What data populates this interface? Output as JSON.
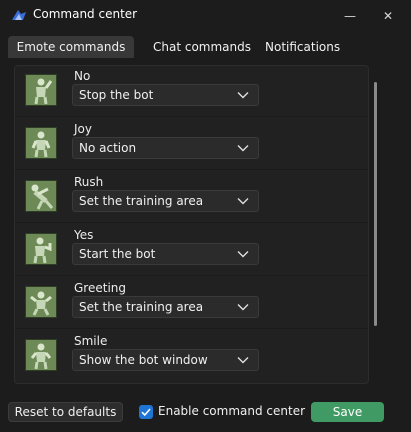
{
  "window": {
    "title": "Command center"
  },
  "tabs": [
    {
      "label": "Emote commands",
      "active": true
    },
    {
      "label": "Chat commands",
      "active": false
    },
    {
      "label": "Notifications",
      "active": false
    }
  ],
  "emotes": [
    {
      "name": "No",
      "action": "Stop the bot",
      "icon": "emote-no-icon"
    },
    {
      "name": "Joy",
      "action": "No action",
      "icon": "emote-joy-icon"
    },
    {
      "name": "Rush",
      "action": "Set the training area",
      "icon": "emote-rush-icon"
    },
    {
      "name": "Yes",
      "action": "Start the bot",
      "icon": "emote-yes-icon"
    },
    {
      "name": "Greeting",
      "action": "Set the training area",
      "icon": "emote-greeting-icon"
    },
    {
      "name": "Smile",
      "action": "Show the bot window",
      "icon": "emote-smile-icon"
    }
  ],
  "footer": {
    "reset_label": "Reset to defaults",
    "enable_label": "Enable command center",
    "enable_checked": true,
    "save_label": "Save"
  },
  "colors": {
    "background": "#1c1c1c",
    "accent": "#1f75d4",
    "save": "#3f9b63",
    "emote_tile": "#6d8a56"
  }
}
